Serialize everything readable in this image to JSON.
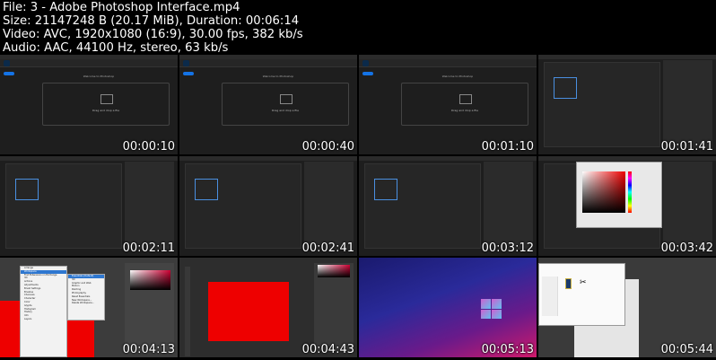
{
  "info": {
    "file": "File: 3 - Adobe Photoshop Interface.mp4",
    "size": "Size: 21147248 B (20.17 MiB), Duration: 00:06:14",
    "video": "Video: AVC, 1920x1080 (16:9), 30.00 fps, 382 kb/s",
    "audio": "Audio: AAC, 44100 Hz, stereo, 63 kb/s"
  },
  "thumbs": [
    {
      "time": "00:00:10",
      "scene": "welcome"
    },
    {
      "time": "00:00:40",
      "scene": "welcome"
    },
    {
      "time": "00:01:10",
      "scene": "welcome"
    },
    {
      "time": "00:01:41",
      "scene": "newdoc"
    },
    {
      "time": "00:02:11",
      "scene": "newdoc"
    },
    {
      "time": "00:02:41",
      "scene": "newdoc"
    },
    {
      "time": "00:03:12",
      "scene": "newdoc"
    },
    {
      "time": "00:03:42",
      "scene": "colorpicker"
    },
    {
      "time": "00:04:13",
      "scene": "menu"
    },
    {
      "time": "00:04:43",
      "scene": "redcanvas"
    },
    {
      "time": "00:05:13",
      "scene": "desktop"
    },
    {
      "time": "00:05:44",
      "scene": "opendialog"
    }
  ],
  "welcome": {
    "title": "Welcome to Photoshop",
    "drop": "Drag and drop a file"
  },
  "menu": {
    "items": [
      "Arrange",
      "Workspace",
      "Find Extensions on Exchange",
      "3D",
      "Actions",
      "Adjustments",
      "Brush Settings",
      "Brushes",
      "Channels",
      "Character",
      "Color",
      "Glyphs",
      "Histogram",
      "History",
      "Info",
      "Layers"
    ],
    "submenu": [
      "Essentials (Default)",
      "3D",
      "Graphic and Web",
      "Motion",
      "Painting",
      "Photography",
      "Reset Essentials",
      "New Workspace...",
      "Delete Workspace..."
    ]
  }
}
